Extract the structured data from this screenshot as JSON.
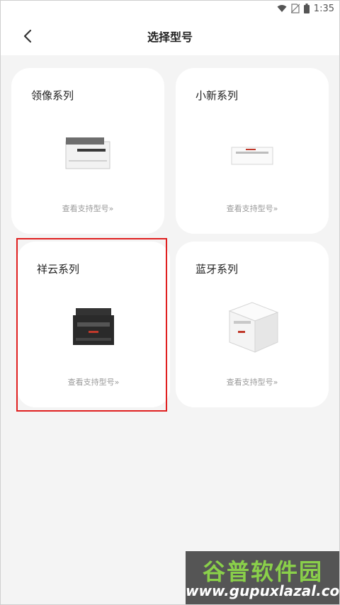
{
  "status_bar": {
    "time": "1:35"
  },
  "header": {
    "title": "选择型号"
  },
  "cards": [
    {
      "name": "领像系列",
      "link": "查看支持型号»"
    },
    {
      "name": "小新系列",
      "link": "查看支持型号»"
    },
    {
      "name": "祥云系列",
      "link": "查看支持型号»"
    },
    {
      "name": "蓝牙系列",
      "link": "查看支持型号»"
    }
  ],
  "watermark": {
    "line1": "谷普软件园",
    "line2": "www.gupuxlazal.com"
  },
  "colors": {
    "highlight": "#e02020",
    "background": "#f4f4f4",
    "card": "#ffffff"
  }
}
